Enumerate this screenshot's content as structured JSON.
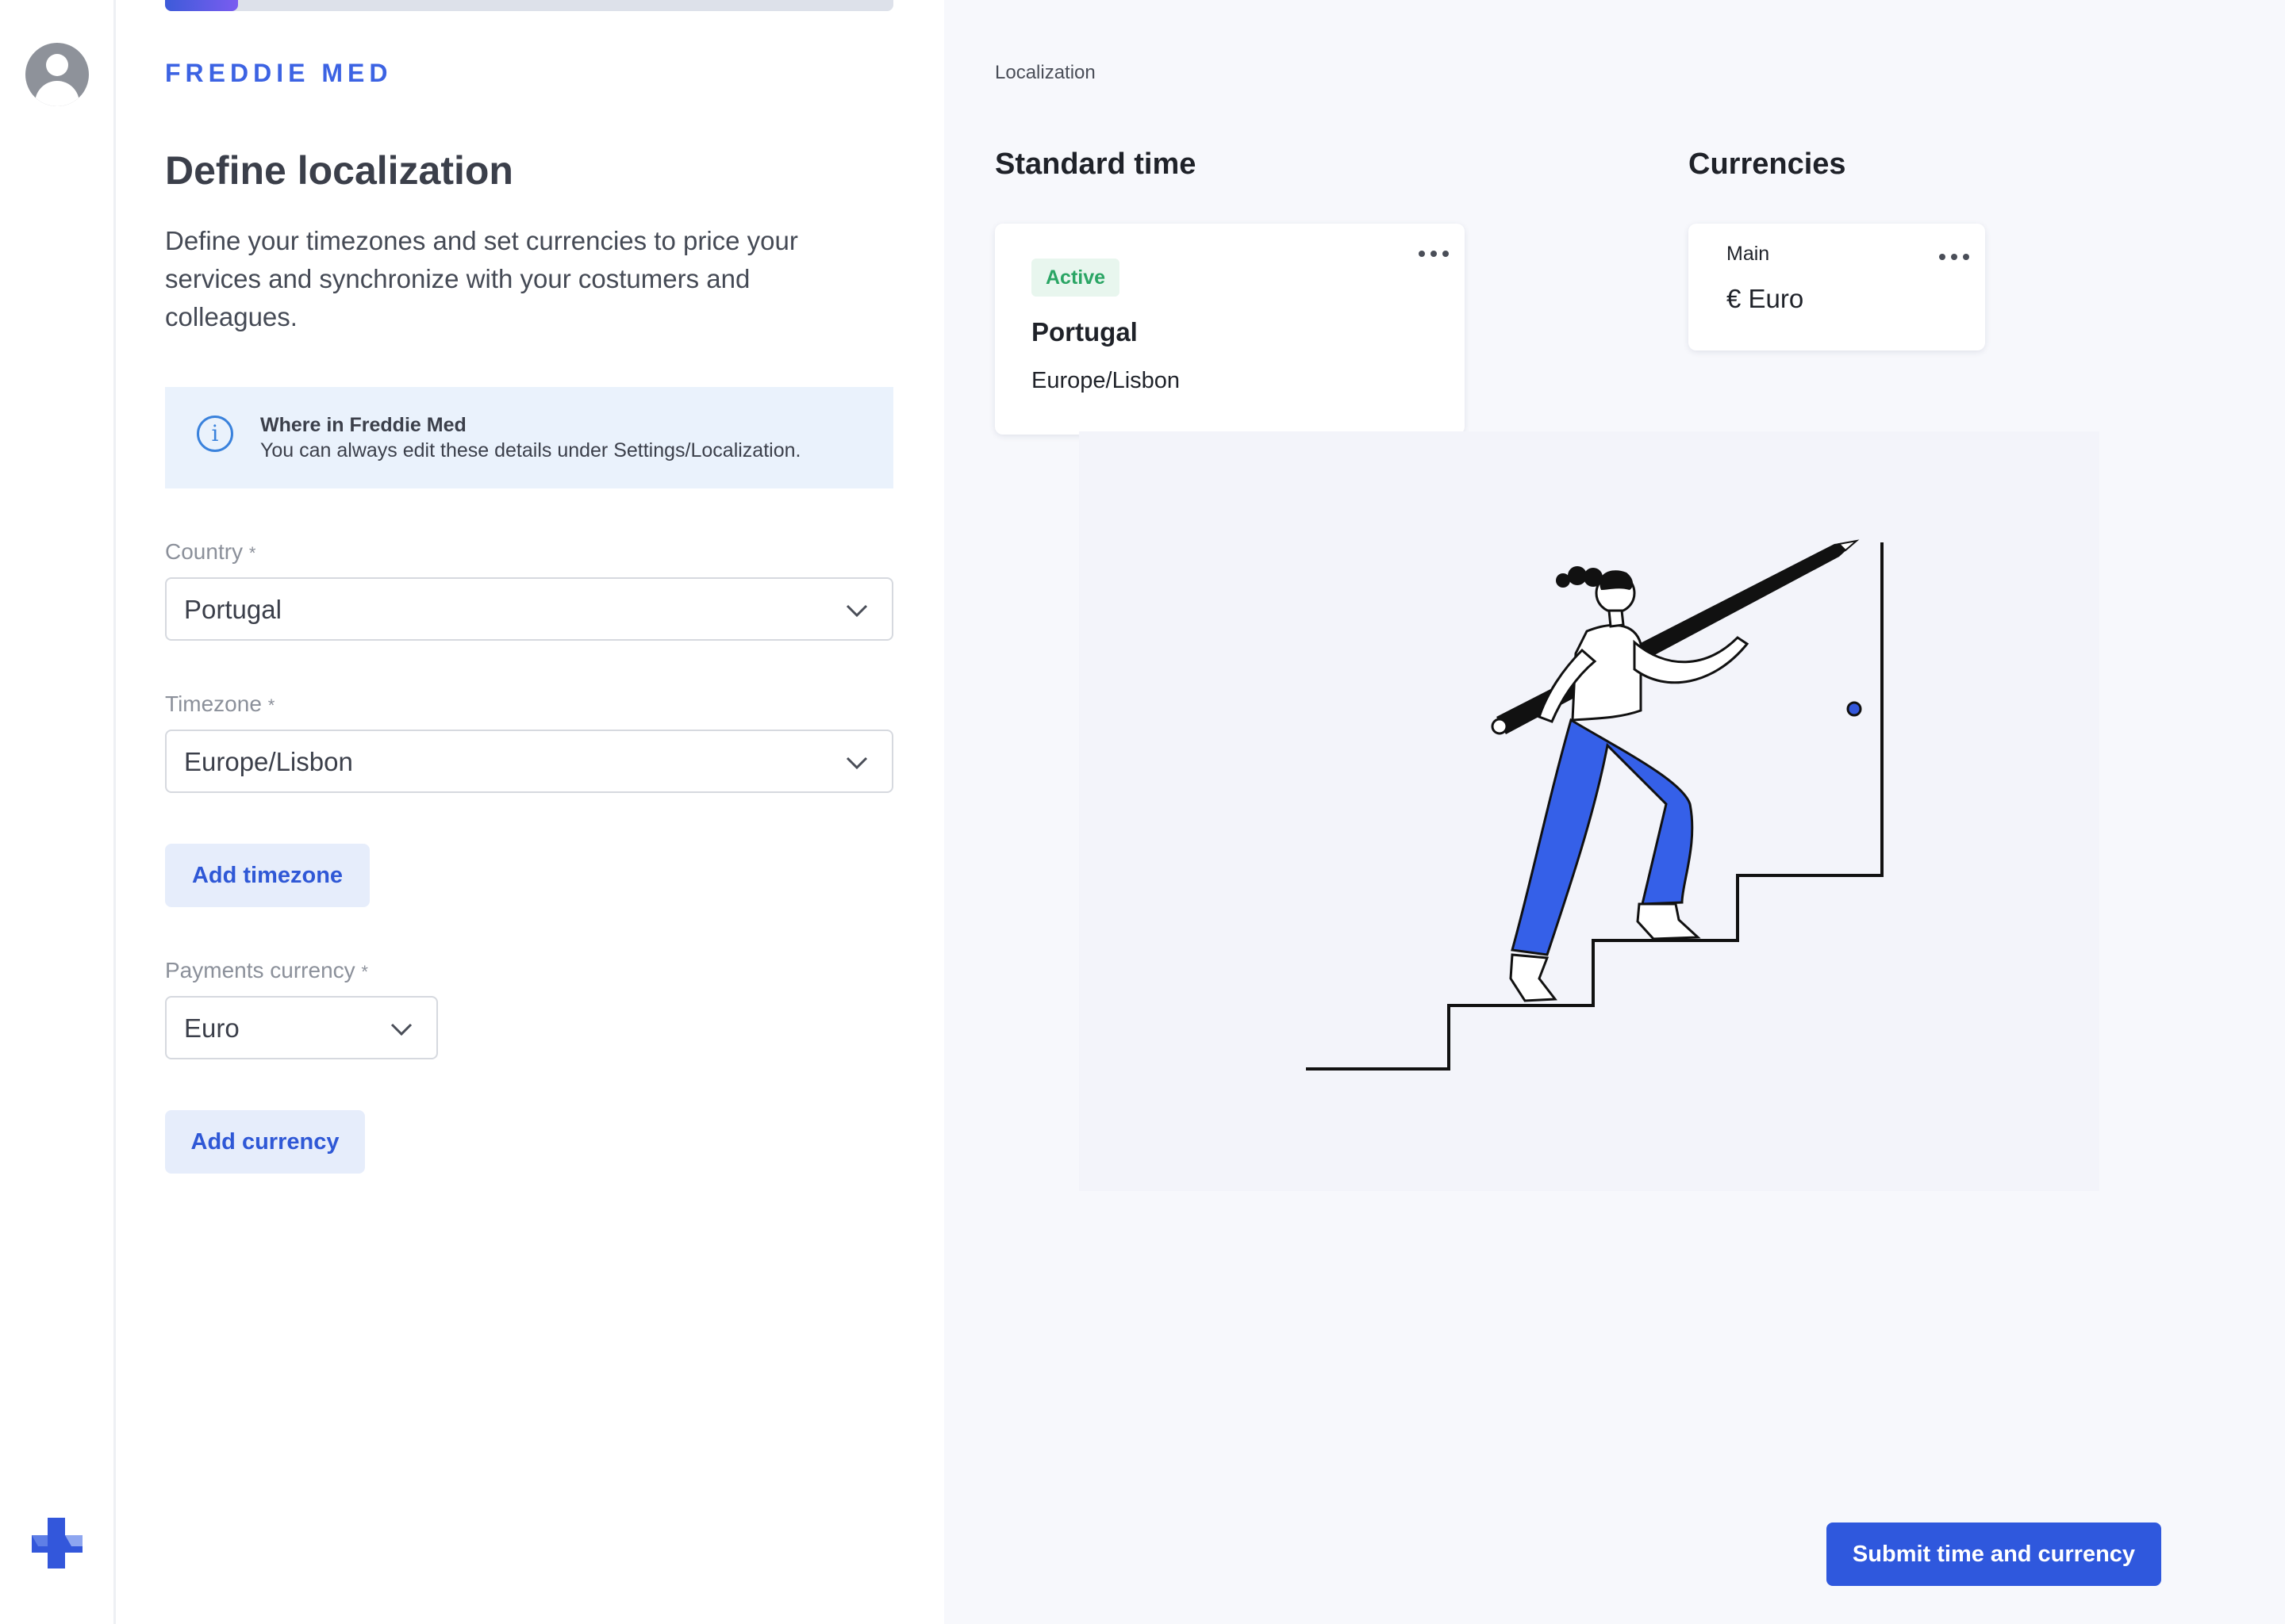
{
  "brand": "FREDDIE MED",
  "progress": 0.1,
  "form": {
    "title": "Define localization",
    "intro": "Define your timezones and set currencies to price your services and synchronize with your costumers and colleagues.",
    "info": {
      "title": "Where in Freddie Med",
      "text": "You can always edit these details under Settings/Localization.",
      "icon": "info-icon"
    },
    "country": {
      "label": "Country",
      "required_mark": "*",
      "value": "Portugal"
    },
    "timezone": {
      "label": "Timezone",
      "required_mark": "*",
      "value": "Europe/Lisbon"
    },
    "add_timezone": "Add timezone",
    "currency": {
      "label": "Payments currency",
      "required_mark": "*",
      "value": "Euro"
    },
    "add_currency": "Add currency"
  },
  "summary": {
    "breadcrumb": "Localization",
    "standard_time": {
      "title": "Standard time",
      "card": {
        "badge": "Active",
        "country": "Portugal",
        "timezone": "Europe/Lisbon"
      }
    },
    "currencies": {
      "title": "Currencies",
      "card": {
        "label": "Main",
        "value": "€ Euro"
      }
    },
    "submit": "Submit time and currency"
  },
  "colors": {
    "accent": "#2f58dd",
    "accent_light": "#e6edfb",
    "active_green": "#2aa564",
    "info_bg": "#eaf2fc"
  }
}
